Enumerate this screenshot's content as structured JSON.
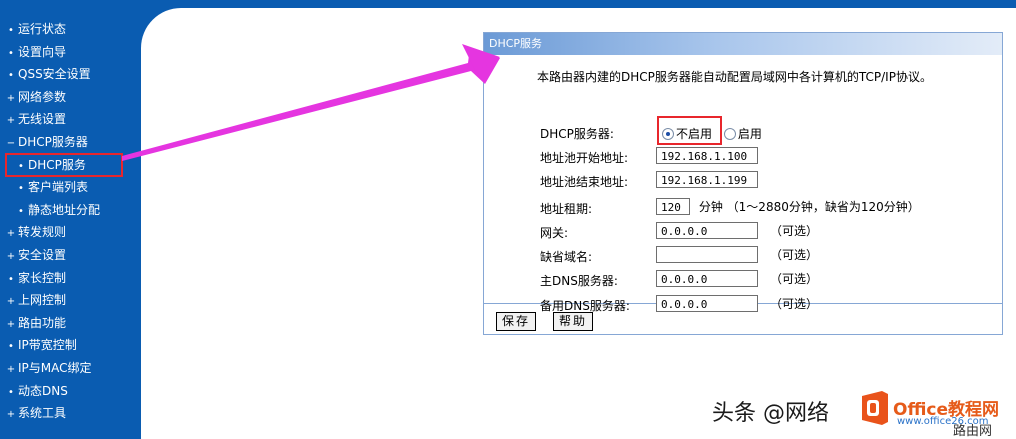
{
  "sidebar": {
    "items": [
      {
        "mark": "•",
        "label": "运行状态"
      },
      {
        "mark": "•",
        "label": "设置向导"
      },
      {
        "mark": "•",
        "label": "QSS安全设置"
      },
      {
        "mark": "+",
        "label": "网络参数"
      },
      {
        "mark": "+",
        "label": "无线设置"
      },
      {
        "mark": "−",
        "label": "DHCP服务器"
      },
      {
        "mark": "•",
        "label": "DHCP服务"
      },
      {
        "mark": "•",
        "label": "客户端列表"
      },
      {
        "mark": "•",
        "label": "静态地址分配"
      },
      {
        "mark": "+",
        "label": "转发规则"
      },
      {
        "mark": "+",
        "label": "安全设置"
      },
      {
        "mark": "•",
        "label": "家长控制"
      },
      {
        "mark": "+",
        "label": "上网控制"
      },
      {
        "mark": "+",
        "label": "路由功能"
      },
      {
        "mark": "•",
        "label": "IP带宽控制"
      },
      {
        "mark": "+",
        "label": "IP与MAC绑定"
      },
      {
        "mark": "•",
        "label": "动态DNS"
      },
      {
        "mark": "+",
        "label": "系统工具"
      }
    ]
  },
  "panel": {
    "title": "DHCP服务",
    "description": "本路由器内建的DHCP服务器能自动配置局域网中各计算机的TCP/IP协议。",
    "dhcp_server": {
      "label": "DHCP服务器:",
      "option_off": "不启用",
      "option_on": "启用",
      "selected": "不启用"
    },
    "pool_start": {
      "label": "地址池开始地址:",
      "value": "192.168.1.100"
    },
    "pool_end": {
      "label": "地址池结束地址:",
      "value": "192.168.1.199"
    },
    "lease": {
      "label": "地址租期:",
      "value": "120",
      "unit": "分钟",
      "hint": "（1～2880分钟，缺省为120分钟）"
    },
    "gateway": {
      "label": "网关:",
      "value": "0.0.0.0",
      "note": "（可选）"
    },
    "domain": {
      "label": "缺省域名:",
      "value": "",
      "note": "（可选）"
    },
    "dns1": {
      "label": "主DNS服务器:",
      "value": "0.0.0.0",
      "note": "（可选）"
    },
    "dns2": {
      "label": "备用DNS服务器:",
      "value": "0.0.0.0",
      "note": "（可选）"
    },
    "save_label": "保存",
    "help_label": "帮助"
  },
  "watermark": {
    "text": "头条 @网络",
    "site": "Office教程网",
    "url": "www.office26.com",
    "corner": "路由网"
  },
  "colors": {
    "sidebar_bg": "#0a5cb1",
    "highlight_red": "#e8262c",
    "arrow_magenta": "#e535e0"
  }
}
